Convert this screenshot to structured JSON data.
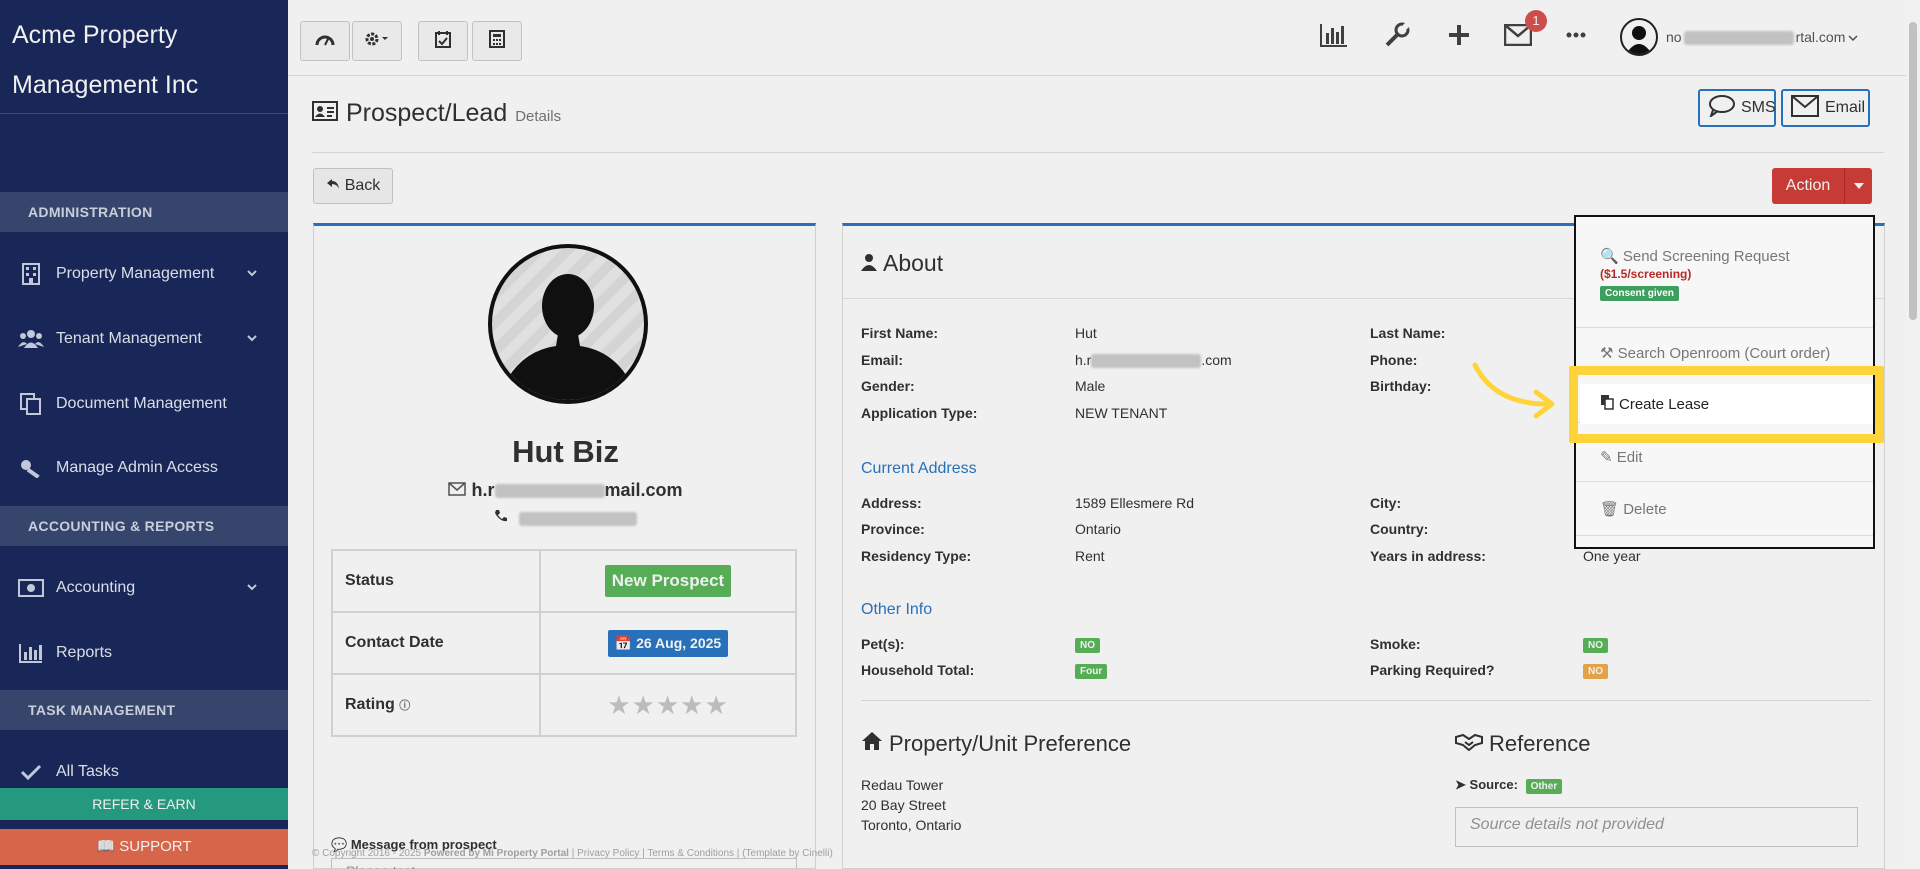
{
  "brand": {
    "line1": "Acme Property",
    "line2": "Management Inc"
  },
  "sidebar": {
    "sections": {
      "administration": "ADMINISTRATION",
      "accounting": "ACCOUNTING & REPORTS",
      "tasks": "TASK MANAGEMENT"
    },
    "items": [
      {
        "label": "Property Management",
        "icon": "building-icon",
        "has_chevron": true
      },
      {
        "label": "Tenant Management",
        "icon": "users-icon",
        "has_chevron": true
      },
      {
        "label": "Document Management",
        "icon": "copy-icon",
        "has_chevron": false
      },
      {
        "label": "Manage Admin Access",
        "icon": "key-icon",
        "has_chevron": false
      },
      {
        "label": "Accounting",
        "icon": "money-icon",
        "has_chevron": true
      },
      {
        "label": "Reports",
        "icon": "bar-chart-icon",
        "has_chevron": false
      },
      {
        "label": "All Tasks",
        "icon": "check-icon",
        "has_chevron": false
      }
    ],
    "refer": "REFER & EARN",
    "support": "SUPPORT"
  },
  "topbar": {
    "notification_count": "1",
    "user_email_prefix": "no",
    "user_email_suffix": "rtal.com"
  },
  "page": {
    "title": "Prospect/Lead",
    "subtitle": "Details",
    "sms_label": "SMS",
    "email_label": "Email",
    "back_label": "Back",
    "action_label": "Action"
  },
  "profile": {
    "name": "Hut Biz",
    "email_prefix": "h.r",
    "email_suffix": "mail.com",
    "status_key": "Status",
    "status_value": "New Prospect",
    "contact_key": "Contact Date",
    "contact_value": "26 Aug, 2025",
    "rating_key": "Rating",
    "rating_value": 0,
    "rating_max": 5,
    "message_label": "Message from prospect",
    "message_preview": "Please test"
  },
  "about": {
    "title": "About",
    "first_name_key": "First Name:",
    "first_name": "Hut",
    "last_name_key": "Last Name:",
    "email_key": "Email:",
    "email_prefix": "h.r",
    "email_suffix": ".com",
    "phone_key": "Phone:",
    "gender_key": "Gender:",
    "gender": "Male",
    "birthday_key": "Birthday:",
    "app_type_key": "Application Type:",
    "app_type": "NEW TENANT",
    "current_address_title": "Current Address",
    "address_key": "Address:",
    "address": "1589 Ellesmere Rd",
    "city_key": "City:",
    "province_key": "Province:",
    "province": "Ontario",
    "country_key": "Country:",
    "residency_key": "Residency Type:",
    "residency": "Rent",
    "years_key": "Years in address:",
    "years": "One year",
    "other_info_title": "Other Info",
    "pets_key": "Pet(s):",
    "pets": "NO",
    "smoke_key": "Smoke:",
    "smoke": "NO",
    "household_key": "Household Total:",
    "household": "Four",
    "parking_key": "Parking Required?",
    "parking": "NO"
  },
  "preference": {
    "title": "Property/Unit Preference",
    "line1": "Redau Tower",
    "line2": "20 Bay Street",
    "line3": "Toronto, Ontario"
  },
  "reference": {
    "title": "Reference",
    "source_label": "Source:",
    "source_value": "Other",
    "details_placeholder": "Source details not provided"
  },
  "dropdown": {
    "screening": "Send Screening Request",
    "screening_price": "($1.5/screening)",
    "consent": "Consent given",
    "openroom": "Search Openroom (Court order)",
    "create_lease": "Create Lease",
    "edit": "Edit",
    "delete": "Delete"
  },
  "footer": {
    "copyright": "© Copyright 2016 - 2025",
    "powered": "Powered by Mi Property Portal",
    "privacy": "| Privacy Policy",
    "terms": "| Terms & Conditions |",
    "template": "(Template by Cinelli)"
  },
  "colors": {
    "sidebar_bg": "#1a2a5e",
    "accent_blue": "#2b78c5",
    "action_red": "#d43f3a",
    "status_green": "#5cb85c",
    "highlight_yellow": "#ffd43b"
  }
}
